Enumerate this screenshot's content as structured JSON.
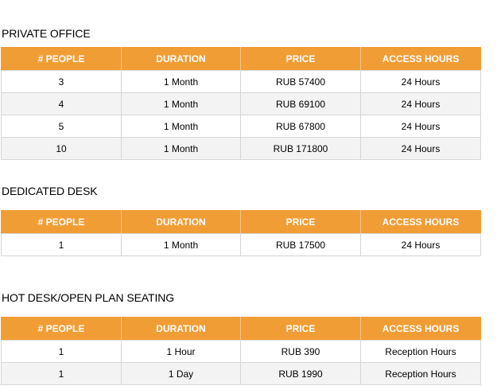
{
  "headers": [
    "# PEOPLE",
    "DURATION",
    "PRICE",
    "ACCESS HOURS"
  ],
  "sections": [
    {
      "title": "PRIVATE OFFICE",
      "rows": [
        [
          "3",
          "1 Month",
          "RUB 57400",
          "24 Hours"
        ],
        [
          "4",
          "1 Month",
          "RUB 69100",
          "24 Hours"
        ],
        [
          "5",
          "1 Month",
          "RUB 67800",
          "24 Hours"
        ],
        [
          "10",
          "1 Month",
          "RUB 171800",
          "24 Hours"
        ]
      ]
    },
    {
      "title": "DEDICATED DESK",
      "rows": [
        [
          "1",
          "1 Month",
          "RUB 17500",
          "24 Hours"
        ]
      ]
    },
    {
      "title": "HOT DESK/OPEN PLAN SEATING",
      "rows": [
        [
          "1",
          "1 Hour",
          "RUB 390",
          "Reception Hours"
        ],
        [
          "1",
          "1 Day",
          "RUB 1990",
          "Reception Hours"
        ]
      ]
    }
  ],
  "colors": {
    "header_background": "#f19d35",
    "header_text": "#ffffff",
    "alt_row_background": "#f3f3f3",
    "border": "#d6d6d6"
  }
}
